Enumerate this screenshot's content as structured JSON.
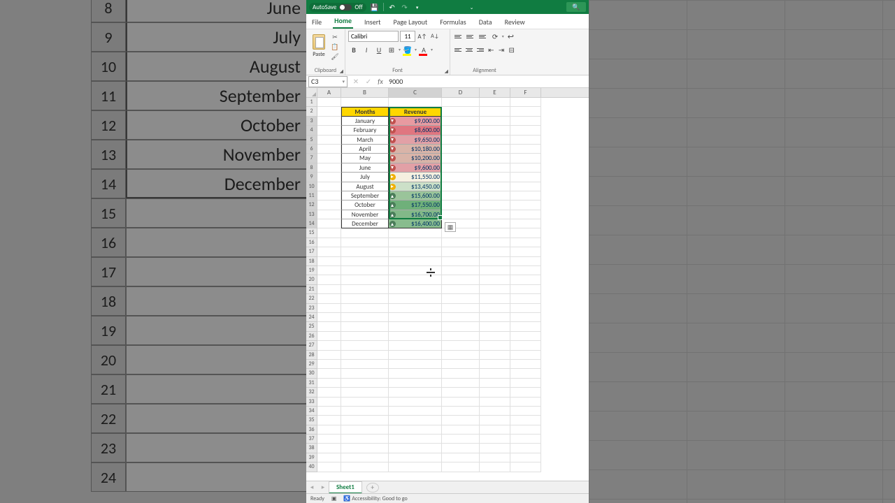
{
  "titlebar": {
    "autosave_label": "AutoSave",
    "autosave_state": "Off"
  },
  "tabs": [
    "File",
    "Home",
    "Insert",
    "Page Layout",
    "Formulas",
    "Data",
    "Review"
  ],
  "active_tab": "Home",
  "ribbon": {
    "clipboard_label": "Clipboard",
    "paste_label": "Paste",
    "font_label": "Font",
    "font_name": "Calibri",
    "font_size": "11",
    "alignment_label": "Alignment"
  },
  "formula_bar": {
    "cell_ref": "C3",
    "value": "9000"
  },
  "columns": [
    "A",
    "B",
    "C",
    "D",
    "E",
    "F"
  ],
  "selected_col": "C",
  "row_count": 40,
  "chart_data": {
    "type": "table",
    "title": "",
    "headers": {
      "months": "Months",
      "revenue": "Revenue"
    },
    "rows": [
      {
        "month": "January",
        "revenue_text": "$9,000.00",
        "revenue": 9000,
        "icon": "down",
        "fill": "#e89aa0"
      },
      {
        "month": "February",
        "revenue_text": "$8,600.00",
        "revenue": 8600,
        "icon": "down",
        "fill": "#e07680"
      },
      {
        "month": "March",
        "revenue_text": "$9,650.00",
        "revenue": 9650,
        "icon": "down",
        "fill": "#e2a0a6"
      },
      {
        "month": "April",
        "revenue_text": "$10,180.00",
        "revenue": 10180,
        "icon": "down",
        "fill": "#d9b4a8"
      },
      {
        "month": "May",
        "revenue_text": "$10,200.00",
        "revenue": 10200,
        "icon": "down",
        "fill": "#d9b4a8"
      },
      {
        "month": "June",
        "revenue_text": "$9,600.00",
        "revenue": 9600,
        "icon": "down",
        "fill": "#e2a0a6"
      },
      {
        "month": "July",
        "revenue_text": "$11,550.00",
        "revenue": 11550,
        "icon": "side",
        "fill": "#f5f0e0"
      },
      {
        "month": "August",
        "revenue_text": "$13,450.00",
        "revenue": 13450,
        "icon": "side",
        "fill": "#cce0c8"
      },
      {
        "month": "September",
        "revenue_text": "$15,600.00",
        "revenue": 15600,
        "icon": "up",
        "fill": "#9ac49a"
      },
      {
        "month": "October",
        "revenue_text": "$17,550.00",
        "revenue": 17550,
        "icon": "up",
        "fill": "#6fb07a"
      },
      {
        "month": "November",
        "revenue_text": "$16,700.00",
        "revenue": 16700,
        "icon": "up",
        "fill": "#82b888"
      },
      {
        "month": "December",
        "revenue_text": "$16,400.00",
        "revenue": 16400,
        "icon": "up",
        "fill": "#88bc8e"
      }
    ]
  },
  "sheets": {
    "active": "Sheet1"
  },
  "statusbar": {
    "ready": "Ready",
    "accessibility": "Accessibility: Good to go"
  },
  "bg_zoom": {
    "row_headers": [
      "8",
      "9",
      "10",
      "11",
      "12",
      "13",
      "14",
      "15",
      "16",
      "17",
      "18",
      "19",
      "20",
      "21",
      "22",
      "23",
      "24"
    ],
    "cells": [
      "June",
      "July",
      "August",
      "September",
      "October",
      "November",
      "December",
      "",
      "",
      "",
      "",
      "",
      "",
      "",
      "",
      "",
      ""
    ]
  }
}
